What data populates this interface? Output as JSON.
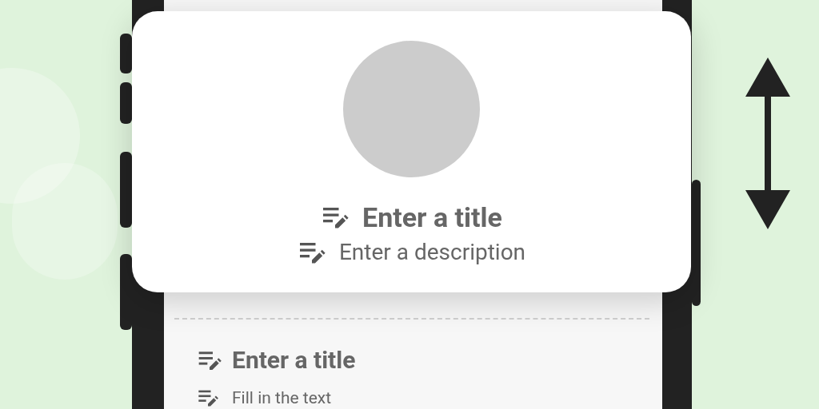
{
  "card": {
    "title": "Enter a title",
    "description": "Enter a description"
  },
  "section": {
    "title": "Enter a title",
    "text": "Fill in the text"
  }
}
